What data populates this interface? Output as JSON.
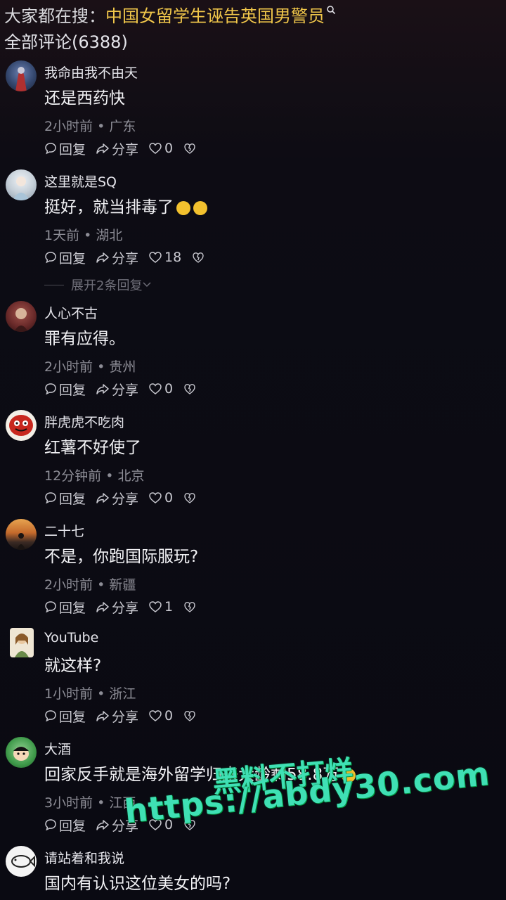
{
  "search": {
    "prefix": "大家都在搜：",
    "query": "中国女留学生诬告英国男警员"
  },
  "comment_count_label": "全部评论(6388)",
  "comments": [
    {
      "username": "我命由我不由天",
      "text": "还是西药快",
      "time": "2小时前",
      "location": "广东",
      "reply": "回复",
      "share": "分享",
      "likes": "0"
    },
    {
      "username": "这里就是SQ",
      "text": "挺好，就当排毒了",
      "time": "1天前",
      "location": "湖北",
      "reply": "回复",
      "share": "分享",
      "likes": "18"
    },
    {
      "username": "人心不古",
      "text": "罪有应得。",
      "time": "2小时前",
      "location": "贵州",
      "reply": "回复",
      "share": "分享",
      "likes": "0"
    },
    {
      "username": "胖虎虎不吃肉",
      "text": "红薯不好使了",
      "time": "12分钟前",
      "location": "北京",
      "reply": "回复",
      "share": "分享",
      "likes": "0"
    },
    {
      "username": "二十七",
      "text": "不是，你跑国际服玩?",
      "time": "2小时前",
      "location": "新疆",
      "reply": "回复",
      "share": "分享",
      "likes": "1"
    },
    {
      "username": "YouTube",
      "text": "就这样?",
      "time": "1小时前",
      "location": "浙江",
      "reply": "回复",
      "share": "分享",
      "likes": "0"
    },
    {
      "username": "大酒",
      "text": "回家反手就是海外留学归来大龄剩",
      "text_tail": "58.8万",
      "time": "3小时前",
      "location": "江西",
      "reply": "回复",
      "share": "分享",
      "likes": "0"
    },
    {
      "username": "请站着和我说",
      "text": "国内有认识这位美女的吗?",
      "time": "",
      "location": "",
      "reply": "",
      "share": "",
      "likes": ""
    }
  ],
  "expand_replies": "展开2条回复",
  "meta_separator": "•",
  "watermark": {
    "line1": "黑料不打烊",
    "line2": "https://abdy30.com"
  },
  "colors": {
    "background": "#0b0b12",
    "search_query": "#f0c64a",
    "watermark": "#3fe0b4"
  }
}
